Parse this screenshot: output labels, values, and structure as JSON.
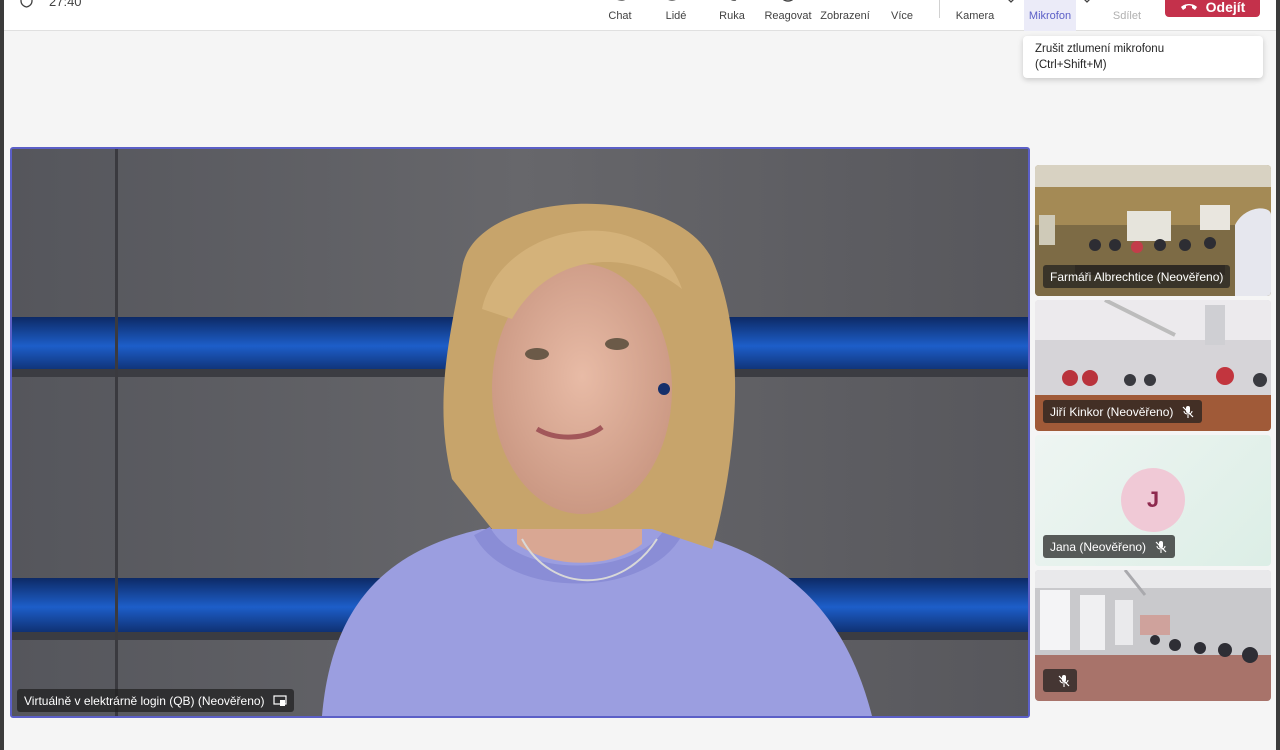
{
  "toolbar": {
    "timer": "27:40",
    "buttons": {
      "chat": "Chat",
      "people": "Lidé",
      "hand": "Ruka",
      "react": "Reagovat",
      "view": "Zobrazení",
      "more": "Více",
      "camera": "Kamera",
      "mic": "Mikrofon",
      "share": "Sdílet"
    },
    "leave": "Odejít",
    "accent": "#5b5fc7",
    "leave_color": "#c4314b"
  },
  "tooltip": {
    "line1": "Zrušit ztlumení mikrofonu",
    "line2": "(Ctrl+Shift+M)"
  },
  "main_video": {
    "name": "Virtuálně v elektrárně login (QB) (Neověřeno)"
  },
  "participants": [
    {
      "name": "Farmáři Albrechtice (Neověřeno)",
      "muted": false
    },
    {
      "name": "Jiří Kinkor (Neověřeno)",
      "muted": true
    },
    {
      "name": "Jana (Neověřeno)",
      "muted": true,
      "initial": "J"
    },
    {
      "name": "",
      "muted": true
    }
  ]
}
